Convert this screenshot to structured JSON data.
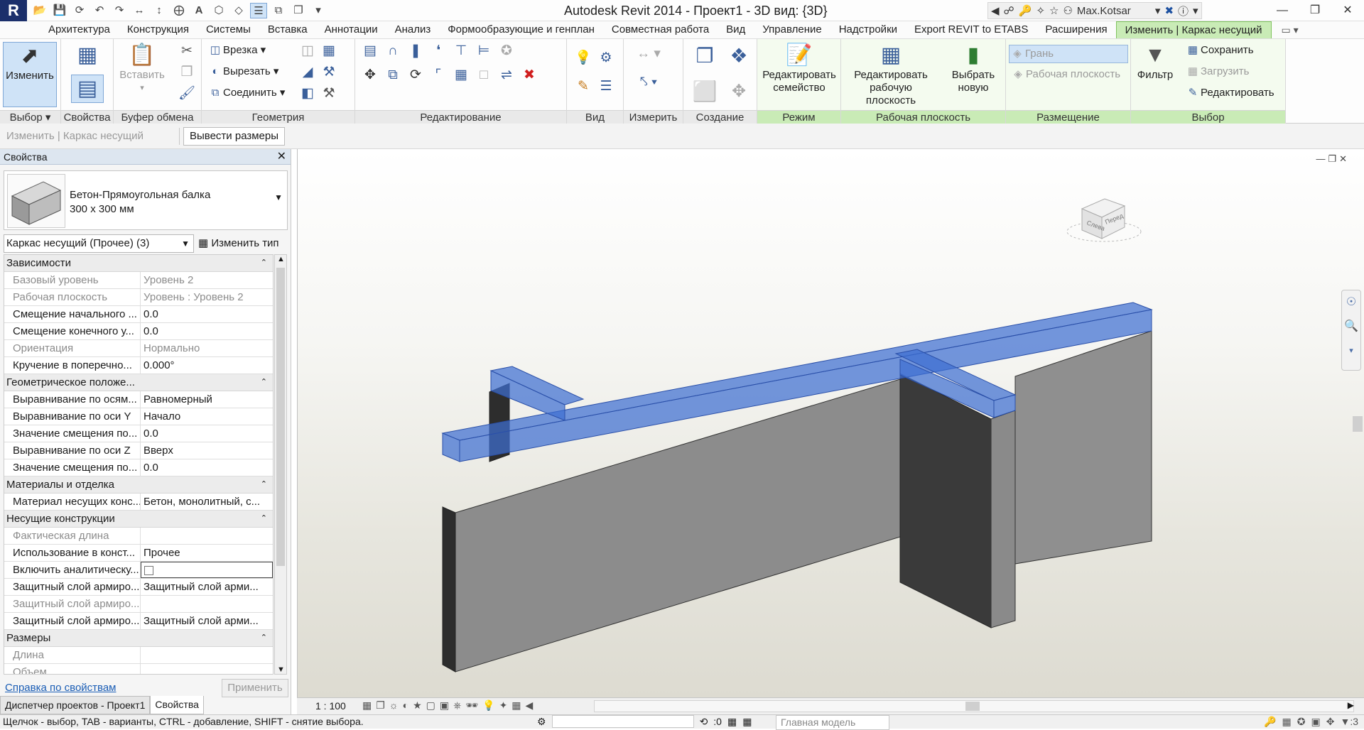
{
  "app": {
    "logo": "R",
    "title": "Autodesk Revit 2014 -     Проект1 - 3D вид: {3D}",
    "user": "Max.Kotsar"
  },
  "qat": [
    "open-icon",
    "save-icon",
    "sync-icon",
    "undo-icon",
    "redo-icon",
    "measure-icon",
    "dimension-icon",
    "tag-icon",
    "text-icon",
    "3d-view-icon",
    "section-icon",
    "thin-lines-icon",
    "close-hidden-icon",
    "switch-windows-icon",
    "customize-icon"
  ],
  "tabs": [
    "Архитектура",
    "Конструкция",
    "Системы",
    "Вставка",
    "Аннотации",
    "Анализ",
    "Формообразующие и генплан",
    "Совместная работа",
    "Вид",
    "Управление",
    "Надстройки",
    "Export REVIT to ETABS",
    "Расширения",
    "Изменить | Каркас несущий"
  ],
  "ribbon": {
    "select": {
      "modify": "Изменить",
      "label": "Выбор"
    },
    "properties": {
      "label": "Свойства"
    },
    "clipboard": {
      "paste": "Вставить",
      "label": "Буфер обмена"
    },
    "geometry": {
      "cope": "Врезка",
      "cut": "Вырезать",
      "join": "Соединить",
      "label": "Геометрия"
    },
    "modify": {
      "label": "Редактирование"
    },
    "view": {
      "label": "Вид"
    },
    "measure": {
      "label": "Измерить"
    },
    "create": {
      "label": "Создание"
    },
    "mode": {
      "edit_family": "Редактировать семейство",
      "label": "Режим"
    },
    "workplane": {
      "edit_wp": "Редактировать рабочую плоскость",
      "pick_new": "Выбрать новую",
      "label": "Рабочая плоскость"
    },
    "placement": {
      "face": "Грань",
      "workplane": "Рабочая плоскость",
      "label": "Размещение"
    },
    "selection": {
      "filter": "Фильтр",
      "save": "Сохранить",
      "load": "Загрузить",
      "edit": "Редактировать",
      "label": "Выбор"
    }
  },
  "options_bar": {
    "context": "Изменить | Каркас несущий",
    "button": "Вывести размеры"
  },
  "properties": {
    "title": "Свойства",
    "type_name": "Бетон-Прямоугольная балка",
    "type_size": "300 х 300 мм",
    "filter": "Каркас несущий (Прочее) (3)",
    "edit_type": "Изменить тип",
    "groups": [
      {
        "name": "Зависимости",
        "rows": [
          {
            "k": "Базовый уровень",
            "v": "Уровень 2",
            "ro": true
          },
          {
            "k": "Рабочая плоскость",
            "v": "Уровень : Уровень 2",
            "ro": true
          },
          {
            "k": "Смещение начального ...",
            "v": "0.0",
            "ro": false
          },
          {
            "k": "Смещение конечного у...",
            "v": "0.0",
            "ro": false
          },
          {
            "k": "Ориентация",
            "v": "Нормально",
            "ro": true
          },
          {
            "k": "Кручение в поперечно...",
            "v": "0.000°",
            "ro": false
          }
        ]
      },
      {
        "name": "Геометрическое положе...",
        "rows": [
          {
            "k": "Выравнивание по осям...",
            "v": "Равномерный",
            "ro": false
          },
          {
            "k": "Выравнивание по оси Y",
            "v": "Начало",
            "ro": false
          },
          {
            "k": "Значение смещения по...",
            "v": "0.0",
            "ro": false
          },
          {
            "k": "Выравнивание по оси Z",
            "v": "Вверх",
            "ro": false
          },
          {
            "k": "Значение смещения по...",
            "v": "0.0",
            "ro": false
          }
        ]
      },
      {
        "name": "Материалы и отделка",
        "rows": [
          {
            "k": "Материал несущих конс...",
            "v": "Бетон, монолитный, с...",
            "ro": false
          }
        ]
      },
      {
        "name": "Несущие конструкции",
        "rows": [
          {
            "k": "Фактическая длина",
            "v": "",
            "ro": true
          },
          {
            "k": "Использование в конст...",
            "v": "Прочее",
            "ro": false
          },
          {
            "k": "Включить аналитическу...",
            "v": "",
            "ro": false,
            "checkbox": true
          },
          {
            "k": "Защитный слой армиро...",
            "v": "Защитный слой арми...",
            "ro": false
          },
          {
            "k": "Защитный слой армиро...",
            "v": "",
            "ro": true
          },
          {
            "k": "Защитный слой армиро...",
            "v": "Защитный слой арми...",
            "ro": false
          }
        ]
      },
      {
        "name": "Размеры",
        "rows": [
          {
            "k": "Длина",
            "v": "",
            "ro": true
          },
          {
            "k": "Объем",
            "v": "",
            "ro": true
          }
        ]
      }
    ],
    "help": "Справка по свойствам",
    "apply": "Применить"
  },
  "bottom_tabs": [
    "Диспетчер проектов - Проект1",
    "Свойства"
  ],
  "viewcube": {
    "left": "Слева",
    "front": "Перед"
  },
  "view_control": {
    "scale": "1 : 100"
  },
  "status": {
    "message": "Щелчок - выбор, TAB - варианты, CTRL - добавление, SHIFT - снятие выбора.",
    "count": ":0",
    "model": "Главная модель",
    "sel_count": ":3"
  },
  "colors": {
    "selection": "#3f6fd1",
    "ctx_tab": "#c9ebb6",
    "wall": "#8f8f8f"
  }
}
